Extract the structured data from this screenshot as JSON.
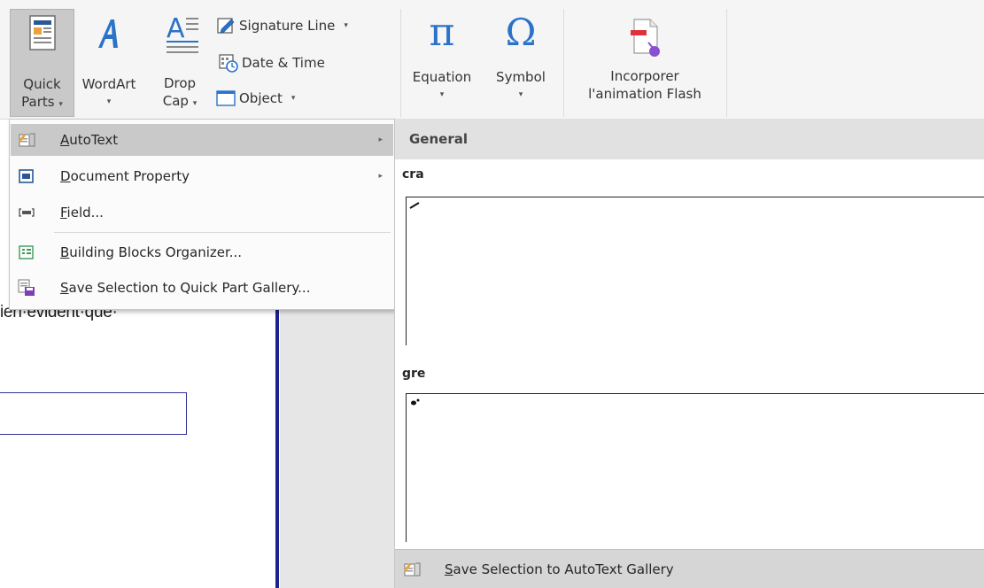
{
  "document": {
    "text_fragment": "ien·évident·que·"
  },
  "ribbon": {
    "quick_parts": {
      "line1": "Quick",
      "line2": "Parts",
      "dropdown": "▾",
      "icon": "quick-parts-icon"
    },
    "wordart": {
      "label": "WordArt",
      "dropdown": "▾",
      "icon": "wordart-icon"
    },
    "drop_cap": {
      "line1": "Drop",
      "line2": "Cap",
      "dropdown": "▾",
      "icon": "drop-cap-icon"
    },
    "signature_line": {
      "label": "Signature Line",
      "dropdown": "▾",
      "icon": "signature-line-icon"
    },
    "date_time": {
      "label": "Date & Time",
      "icon": "date-time-icon"
    },
    "object": {
      "label": "Object",
      "dropdown": "▾",
      "icon": "object-icon"
    },
    "equation": {
      "label": "Equation",
      "glyph": "π",
      "dropdown": "▾"
    },
    "symbol": {
      "label": "Symbol",
      "glyph": "Ω",
      "dropdown": "▾"
    },
    "flash": {
      "line1": "Incorporer",
      "line2": "l'animation Flash",
      "icon": "flash-animation-icon"
    }
  },
  "menu": {
    "items": [
      {
        "prefix": "",
        "underline": "A",
        "rest": "utoText",
        "submenu": "▸",
        "highlighted": true,
        "icon": "autotext-icon"
      },
      {
        "prefix": "",
        "underline": "D",
        "rest": "ocument Property",
        "submenu": "▸",
        "icon": "document-property-icon"
      },
      {
        "prefix": "",
        "underline": "F",
        "rest": "ield...",
        "icon": "field-icon"
      },
      {
        "prefix": "",
        "underline": "B",
        "rest": "uilding Blocks Organizer...",
        "icon": "building-blocks-icon"
      },
      {
        "prefix": "",
        "underline": "S",
        "rest": "ave Selection to Quick Part Gallery...",
        "icon": "save-selection-icon"
      }
    ]
  },
  "gallery": {
    "header": "General",
    "entries": [
      {
        "name": "cra"
      },
      {
        "name": "gre"
      }
    ],
    "footer": {
      "underline": "S",
      "rest": "ave Selection to AutoText Gallery",
      "icon": "autotext-save-icon"
    }
  },
  "colors": {
    "highlight": "#c9c9c9",
    "ribbon_bg": "#f5f5f5",
    "accent_blue": "#2b5797",
    "doc_line": "#1f1f8f"
  }
}
